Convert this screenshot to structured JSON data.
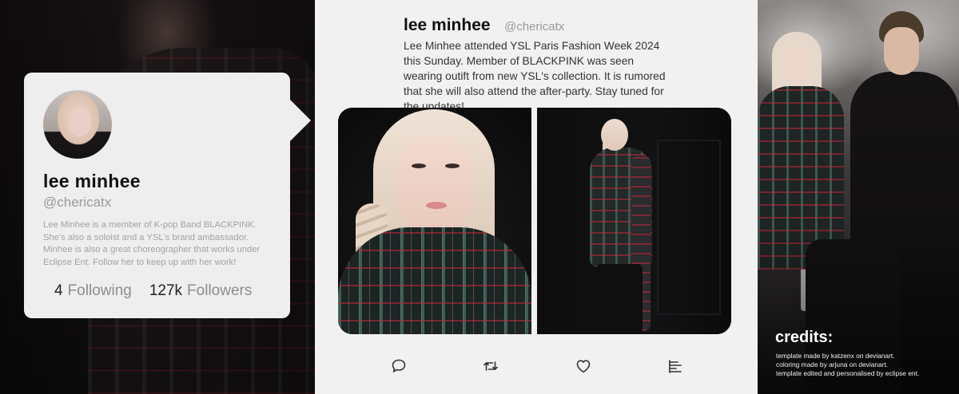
{
  "profile": {
    "name": "lee minhee",
    "handle": "@chericatx",
    "bio": "Lee Minhee is a member of K-pop Band BLACKPINK. She's also a soloist and a YSL's brand ambassador. Minhee is also a great choreographer that works under Eclipse Ent. Follow her to keep up with her work!",
    "following_count": "4",
    "following_label": "Following",
    "followers_count": "127k",
    "followers_label": "Followers"
  },
  "post": {
    "name": "lee minhee",
    "handle": "@chericatx",
    "text": "Lee Minhee attended YSL Paris Fashion Week 2024 this Sunday. Member of BLACKPINK was seen wearing outift from new YSL's collection. It is rumored that she will also attend the after-party. Stay tuned for the updates!",
    "actions": [
      "reply-icon",
      "retweet-icon",
      "like-icon",
      "share-icon"
    ]
  },
  "credits": {
    "title": "credits:",
    "lines": [
      "template made by katzenx on devianart.",
      "coloring made by arjuna on devianart.",
      "template edited and personalised by eclipse ent."
    ]
  },
  "colors": {
    "card": "#eeeeee",
    "post_background": "#f1f1f1",
    "muted_text": "#9a9a9a",
    "page_background": "#0a0a0a"
  }
}
